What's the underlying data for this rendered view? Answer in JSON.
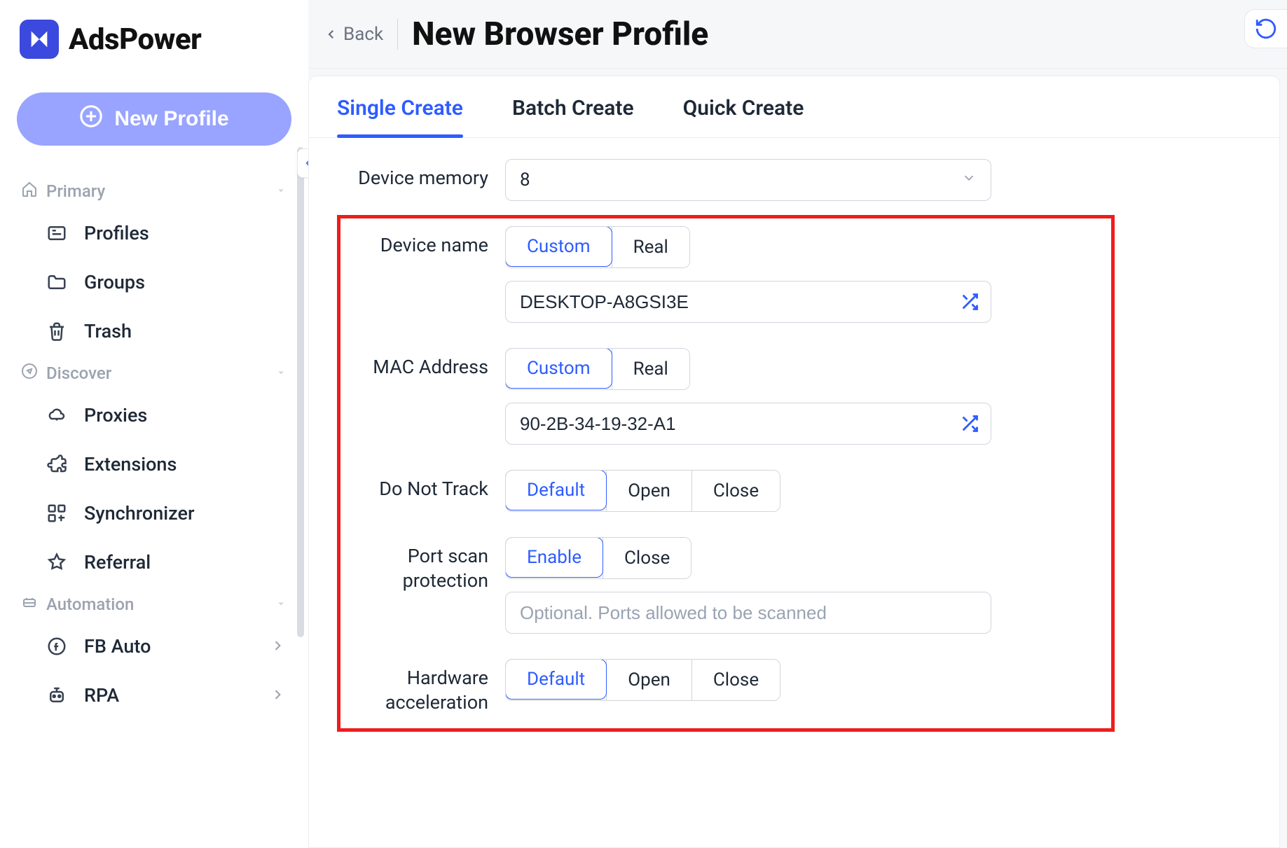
{
  "brand": "AdsPower",
  "header": {
    "back": "Back",
    "title": "New Browser Profile"
  },
  "sidebar": {
    "new_profile": "New Profile",
    "sections": {
      "primary": {
        "label": "Primary",
        "items": [
          {
            "label": "Profiles"
          },
          {
            "label": "Groups"
          },
          {
            "label": "Trash"
          }
        ]
      },
      "discover": {
        "label": "Discover",
        "items": [
          {
            "label": "Proxies"
          },
          {
            "label": "Extensions"
          },
          {
            "label": "Synchronizer"
          },
          {
            "label": "Referral"
          }
        ]
      },
      "automation": {
        "label": "Automation",
        "items": [
          {
            "label": "FB Auto"
          },
          {
            "label": "RPA"
          }
        ]
      }
    }
  },
  "tabs": [
    {
      "label": "Single Create",
      "active": true
    },
    {
      "label": "Batch Create",
      "active": false
    },
    {
      "label": "Quick Create",
      "active": false
    }
  ],
  "form": {
    "device_memory": {
      "label": "Device memory",
      "value": "8"
    },
    "device_name": {
      "label": "Device name",
      "options": [
        "Custom",
        "Real"
      ],
      "selected": "Custom",
      "value": "DESKTOP-A8GSI3E"
    },
    "mac_address": {
      "label": "MAC Address",
      "options": [
        "Custom",
        "Real"
      ],
      "selected": "Custom",
      "value": "90-2B-34-19-32-A1"
    },
    "do_not_track": {
      "label": "Do Not Track",
      "options": [
        "Default",
        "Open",
        "Close"
      ],
      "selected": "Default"
    },
    "port_scan": {
      "label": "Port scan protection",
      "options": [
        "Enable",
        "Close"
      ],
      "selected": "Enable",
      "placeholder": "Optional. Ports allowed to be scanned"
    },
    "hardware_accel": {
      "label": "Hardware acceleration",
      "options": [
        "Default",
        "Open",
        "Close"
      ],
      "selected": "Default"
    }
  }
}
